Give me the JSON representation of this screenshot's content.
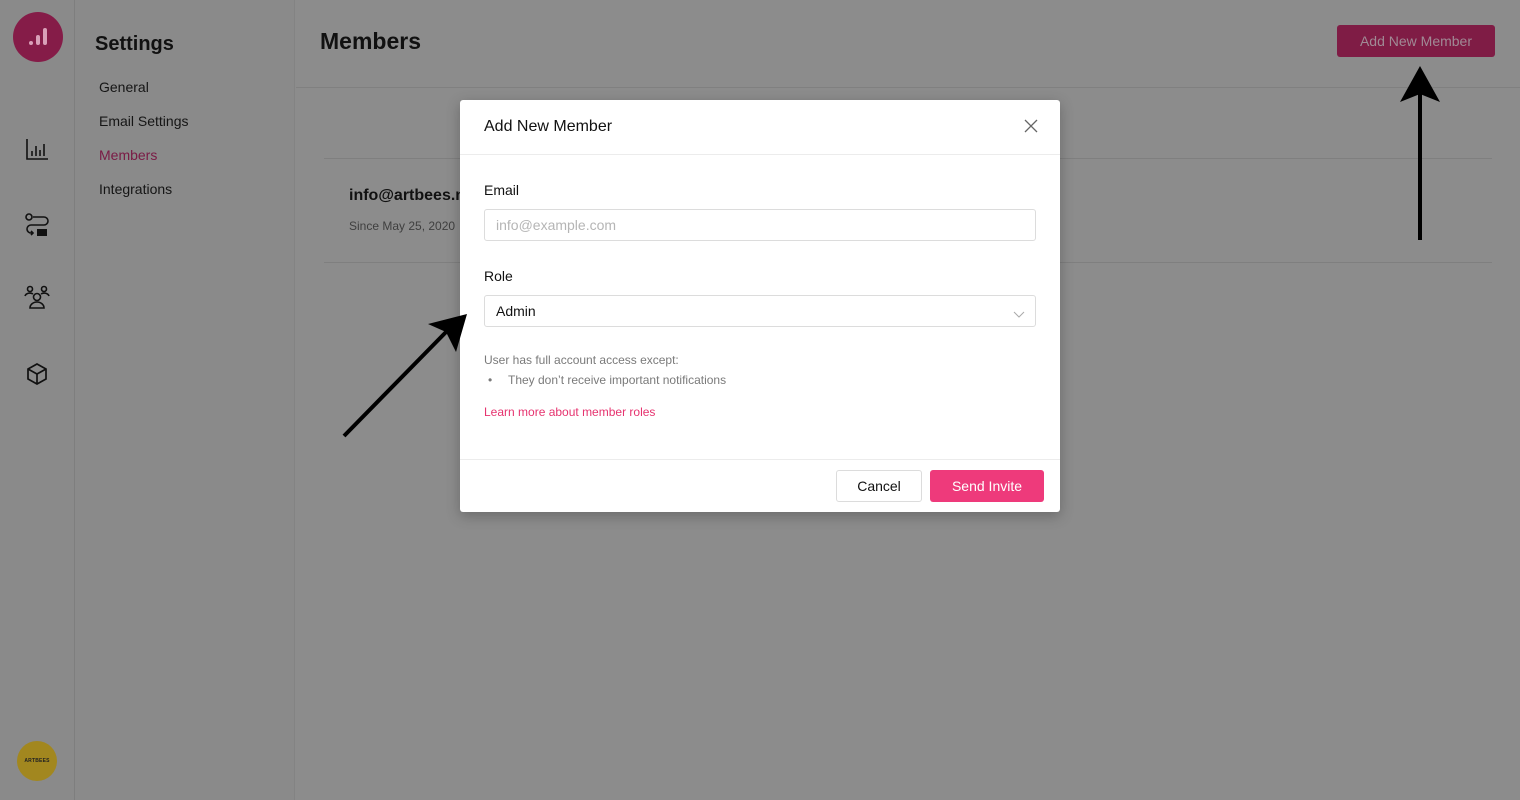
{
  "rail": {
    "logo": "analytics-logo",
    "icons": [
      "bar-chart-icon",
      "flow-icon",
      "team-icon",
      "box-icon"
    ],
    "avatar_text": "ARTBEES"
  },
  "settings_nav": {
    "title": "Settings",
    "items": [
      {
        "label": "General",
        "active": false
      },
      {
        "label": "Email Settings",
        "active": false
      },
      {
        "label": "Members",
        "active": true
      },
      {
        "label": "Integrations",
        "active": false
      }
    ]
  },
  "main": {
    "title": "Members",
    "add_button_label": "Add New Member",
    "members": [
      {
        "email": "info@artbees.net",
        "since": "Since May 25, 2020"
      }
    ]
  },
  "modal": {
    "title": "Add New Member",
    "email_label": "Email",
    "email_value": "",
    "email_placeholder": "info@example.com",
    "role_label": "Role",
    "role_value": "Admin",
    "role_description": "User has full account access except:",
    "role_exceptions": [
      "They don’t receive important notifications"
    ],
    "learn_more_link": "Learn more about member roles",
    "cancel_label": "Cancel",
    "send_label": "Send Invite"
  },
  "colors": {
    "accent": "#ee3a7b",
    "link": "#e6336f",
    "overlay": "#8c8c8c"
  }
}
